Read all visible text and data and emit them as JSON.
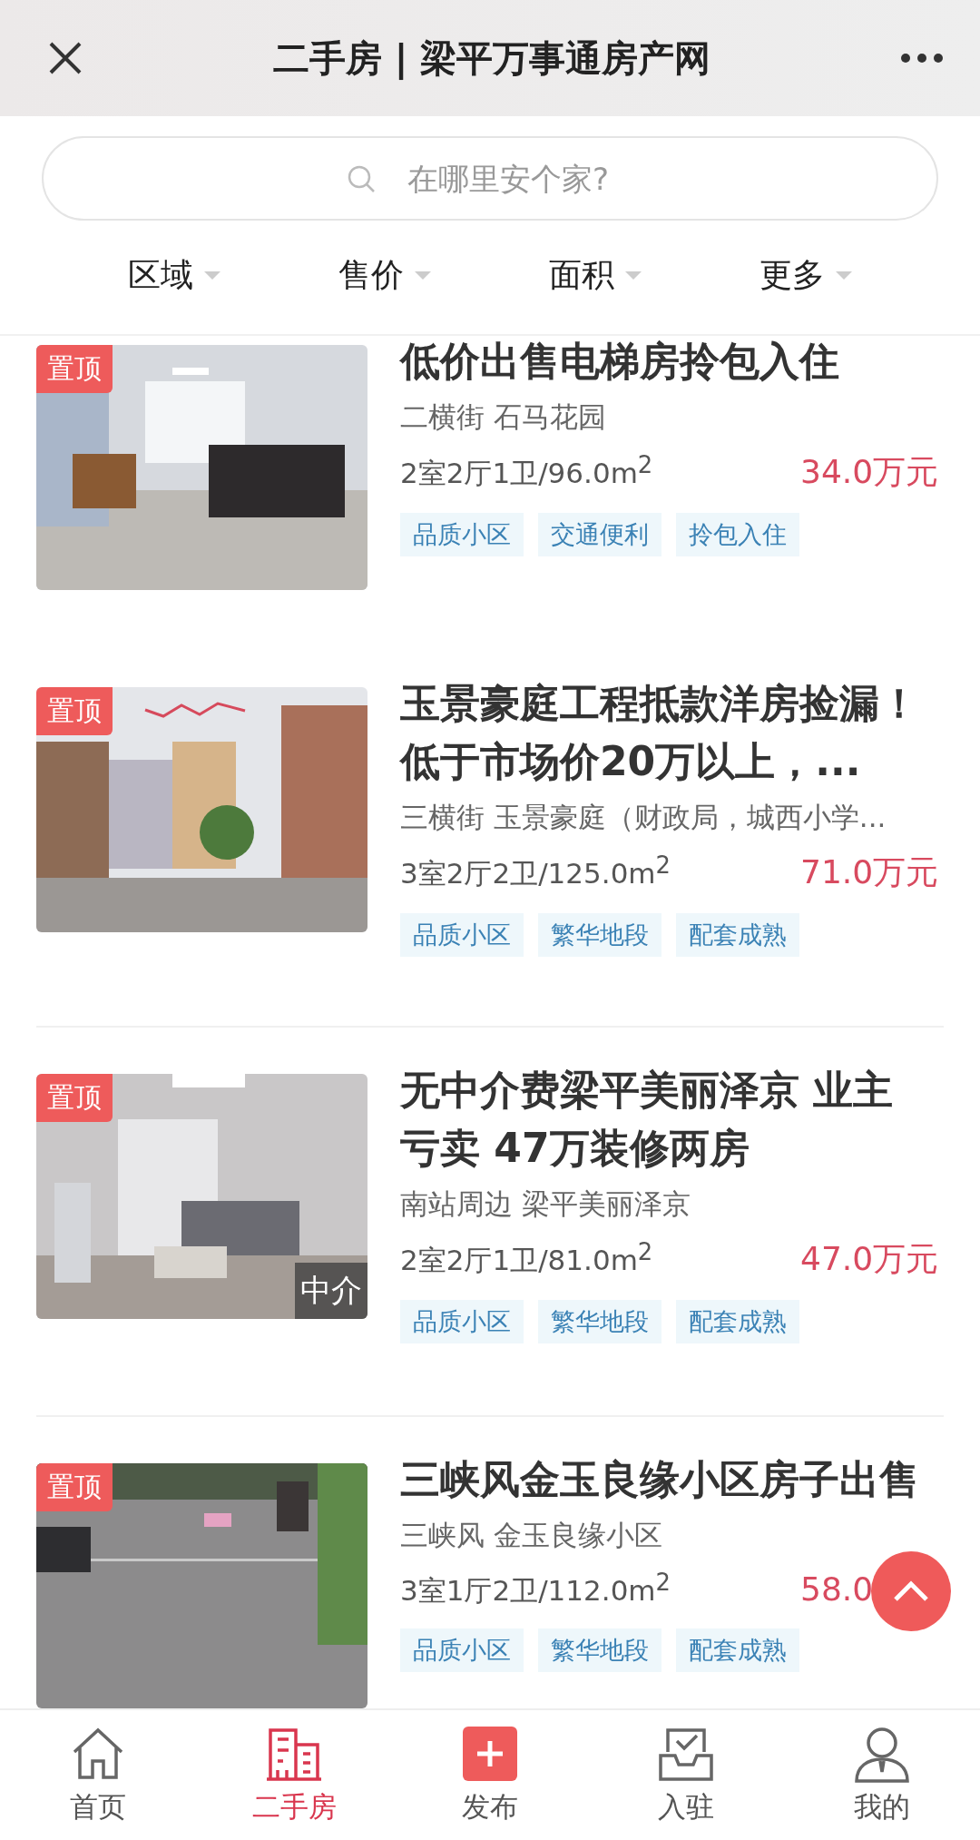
{
  "header": {
    "title": "二手房 | 梁平万事通房产网"
  },
  "search": {
    "placeholder": "在哪里安个家?"
  },
  "filters": [
    {
      "label": "区域"
    },
    {
      "label": "售价"
    },
    {
      "label": "面积"
    },
    {
      "label": "更多"
    }
  ],
  "listings": [
    {
      "badge": "置顶",
      "title": "低价出售电梯房拎包入住",
      "location": "二横街 石马花园",
      "layout": "2室2厅1卫/96.0m$^{2}$",
      "price": "34.0万元",
      "tags": [
        "品质小区",
        "交通便利",
        "拎包入住"
      ]
    },
    {
      "badge": "置顶",
      "title": "玉景豪庭工程抵款洋房捡漏！低于市场价20万以上，...",
      "location": "三横街 玉景豪庭（财政局，城西小学...",
      "layout": "3室2厅2卫/125.0m$^{2}$",
      "price": "71.0万元",
      "tags": [
        "品质小区",
        "繁华地段",
        "配套成熟"
      ]
    },
    {
      "badge": "置顶",
      "title": "无中介费梁平美丽泽京 业主亏卖 47万装修两房",
      "location": "南站周边 梁平美丽泽京",
      "layout": "2室2厅1卫/81.0m$^{2}$",
      "price": "47.0万元",
      "photo_label": "中介",
      "tags": [
        "品质小区",
        "繁华地段",
        "配套成熟"
      ]
    },
    {
      "badge": "置顶",
      "title": "三峡风金玉良缘小区房子出售",
      "location": "三峡风 金玉良缘小区",
      "layout": "3室1厅2卫/112.0m$^{2}$",
      "price": "58.0",
      "tags": [
        "品质小区",
        "繁华地段",
        "配套成熟"
      ]
    }
  ],
  "tabbar": [
    {
      "label": "首页",
      "kind": "home",
      "selected": false
    },
    {
      "label": "二手房",
      "kind": "building",
      "selected": true
    },
    {
      "label": "发布",
      "kind": "publish",
      "selected": false
    },
    {
      "label": "入驻",
      "kind": "inbox",
      "selected": false
    },
    {
      "label": "我的",
      "kind": "person",
      "selected": false
    }
  ]
}
